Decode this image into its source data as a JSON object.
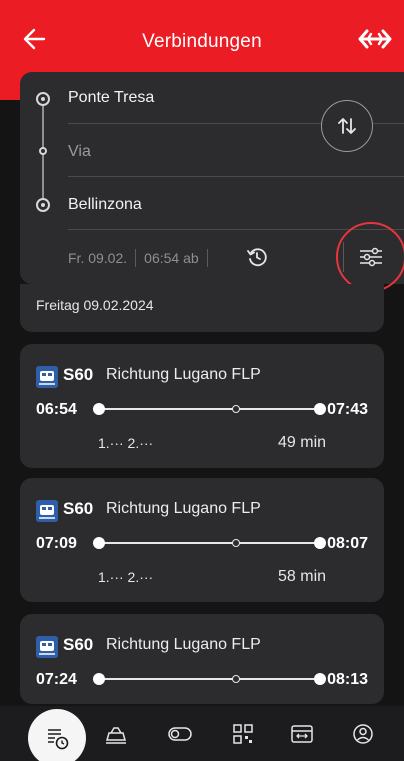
{
  "header": {
    "title": "Verbindungen"
  },
  "search": {
    "from": "Ponte Tresa",
    "via_placeholder": "Via",
    "to": "Bellinzona",
    "date": "Fr. 09.02.",
    "time": "06:54 ab"
  },
  "date_bar": "Freitag 09.02.2024",
  "connections": [
    {
      "line": "S60",
      "direction": "Richtung Lugano FLP",
      "departure": "06:54",
      "arrival": "07:43",
      "occupancy": "1.··· 2.···",
      "duration": "49 min"
    },
    {
      "line": "S60",
      "direction": "Richtung Lugano FLP",
      "departure": "07:09",
      "arrival": "08:07",
      "occupancy": "1.··· 2.···",
      "duration": "58 min"
    },
    {
      "line": "S60",
      "direction": "Richtung Lugano FLP",
      "departure": "07:24",
      "arrival": "08:13",
      "occupancy": "",
      "duration": ""
    }
  ],
  "nav": [
    "timetable-icon",
    "tickets-icon",
    "toggle-icon",
    "qr-code-icon",
    "travel-card-icon",
    "profile-icon"
  ],
  "colors": {
    "brand_red": "#eb1c24",
    "card_bg": "#2c2c2e",
    "background": "#141414"
  }
}
